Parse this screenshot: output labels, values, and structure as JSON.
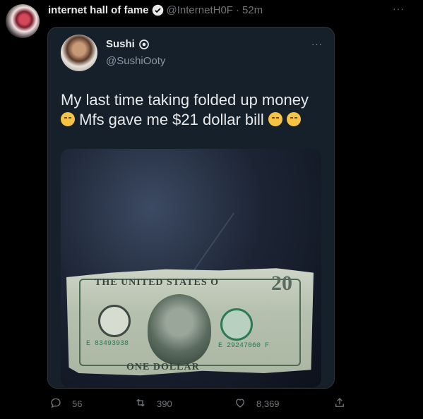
{
  "tweet": {
    "author_name": "internet hall of fame",
    "author_handle": "@InternetH0F",
    "separator": "·",
    "time": "52m",
    "more": "···"
  },
  "quoted": {
    "author_name": "Sushi",
    "author_handle": "@SushiOoty",
    "more": "···",
    "text_line1": "My last time taking folded up money",
    "text_line2": "Mfs gave me $21 dollar bill",
    "photo": {
      "bill_top": "THE UNITED STATES O",
      "bill_bottom": "ONE DOLLAR",
      "bill_corner": "20",
      "serial_left": "E 83493938",
      "serial_right": "E 29247060 F"
    }
  },
  "actions": {
    "replies": "56",
    "retweets": "390",
    "likes": "8,369"
  },
  "colors": {
    "background": "#000000",
    "card": "#15202b",
    "muted": "#71767b",
    "verified_blue": "#1d9bf0"
  }
}
